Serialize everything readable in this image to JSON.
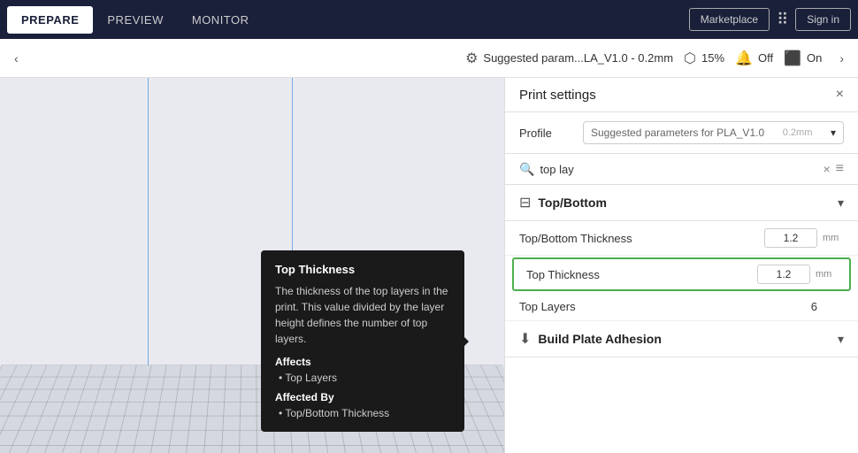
{
  "nav": {
    "prepare_label": "PREPARE",
    "preview_label": "PREVIEW",
    "monitor_label": "MONITOR",
    "marketplace_label": "Marketplace",
    "signin_label": "Sign in"
  },
  "toolbar": {
    "param_label": "Suggested param...LA_V1.0 - 0.2mm",
    "fill_percent": "15%",
    "support_label": "Off",
    "adhesion_label": "On"
  },
  "panel": {
    "title": "Print settings",
    "close_label": "×",
    "profile_label": "Profile",
    "profile_value": "Suggested parameters for PLA_V1.0",
    "profile_size": "0.2mm",
    "search_placeholder": "top lay",
    "search_clear": "×"
  },
  "sections": {
    "top_bottom": {
      "title": "Top/Bottom",
      "rows": [
        {
          "name": "Top/Bottom Thickness",
          "value": "1.2",
          "unit": "mm"
        },
        {
          "name": "Top Thickness",
          "value": "1.2",
          "unit": "mm",
          "highlighted": true
        },
        {
          "name": "Top Layers",
          "value": "6",
          "unit": ""
        }
      ]
    },
    "build_plate": {
      "title": "Build Plate Adhesion"
    }
  },
  "tooltip": {
    "title": "Top Thickness",
    "description": "The thickness of the top layers in the print. This value divided by the layer height defines the number of top layers.",
    "affects_label": "Affects",
    "affects_items": [
      "Top Layers"
    ],
    "affected_by_label": "Affected By",
    "affected_by_items": [
      "Top/Bottom Thickness"
    ]
  }
}
